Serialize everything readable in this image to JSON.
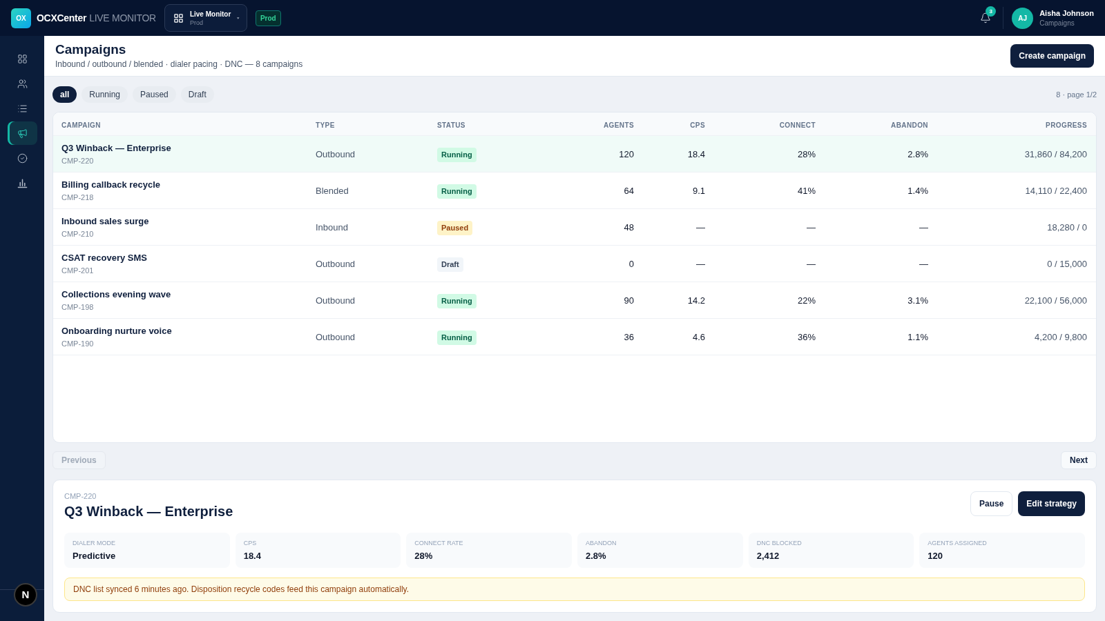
{
  "header": {
    "logo": {
      "mark": "OX",
      "name": "OCXCenter",
      "product": "LIVE MONITOR"
    },
    "workspace": {
      "title": "Live Monitor",
      "subtitle": "Prod"
    },
    "environment": "Prod",
    "notifications": {
      "count": "3"
    },
    "user": {
      "initials": "AJ",
      "name": "Aisha Johnson",
      "subtitle": "Campaigns"
    }
  },
  "sidebar": {
    "items": [
      {
        "selected": false
      },
      {
        "selected": false
      },
      {
        "selected": false
      },
      {
        "selected": true
      },
      {
        "selected": false
      },
      {
        "selected": false
      }
    ],
    "dev_indicator": "N"
  },
  "page": {
    "title": "Campaigns",
    "subtitle": "Inbound / outbound / blended · dialer pacing · DNC — 8 campaigns",
    "action": "Create campaign"
  },
  "filters": {
    "tabs": [
      {
        "label": "all",
        "selected": true
      },
      {
        "label": "Running",
        "selected": false
      },
      {
        "label": "Paused",
        "selected": false
      },
      {
        "label": "Draft",
        "selected": false
      }
    ],
    "summary": "8 · page 1/2"
  },
  "table": {
    "columns": [
      "CAMPAIGN",
      "TYPE",
      "STATUS",
      "AGENTS",
      "CPS",
      "CONNECT",
      "ABANDON",
      "PROGRESS"
    ],
    "rows": [
      {
        "name": "Q3 Winback — Enterprise",
        "id": "CMP-220",
        "type": "Outbound",
        "status": {
          "label": "Running",
          "kind": "running"
        },
        "agents": "120",
        "cps": "18.4",
        "connect": "28%",
        "abandon": "2.8%",
        "progress": "31,860 / 84,200",
        "selected": true
      },
      {
        "name": "Billing callback recycle",
        "id": "CMP-218",
        "type": "Blended",
        "status": {
          "label": "Running",
          "kind": "running"
        },
        "agents": "64",
        "cps": "9.1",
        "connect": "41%",
        "abandon": "1.4%",
        "progress": "14,110 / 22,400",
        "selected": false
      },
      {
        "name": "Inbound sales surge",
        "id": "CMP-210",
        "type": "Inbound",
        "status": {
          "label": "Paused",
          "kind": "paused"
        },
        "agents": "48",
        "cps": "—",
        "connect": "—",
        "abandon": "—",
        "progress": "18,280 / 0",
        "selected": false
      },
      {
        "name": "CSAT recovery SMS",
        "id": "CMP-201",
        "type": "Outbound",
        "status": {
          "label": "Draft",
          "kind": "draft"
        },
        "agents": "0",
        "cps": "—",
        "connect": "—",
        "abandon": "—",
        "progress": "0 / 15,000",
        "selected": false
      },
      {
        "name": "Collections evening wave",
        "id": "CMP-198",
        "type": "Outbound",
        "status": {
          "label": "Running",
          "kind": "running"
        },
        "agents": "90",
        "cps": "14.2",
        "connect": "22%",
        "abandon": "3.1%",
        "progress": "22,100 / 56,000",
        "selected": false
      },
      {
        "name": "Onboarding nurture voice",
        "id": "CMP-190",
        "type": "Outbound",
        "status": {
          "label": "Running",
          "kind": "running"
        },
        "agents": "36",
        "cps": "4.6",
        "connect": "36%",
        "abandon": "1.1%",
        "progress": "4,200 / 9,800",
        "selected": false
      }
    ]
  },
  "pagination": {
    "previous": {
      "label": "Previous",
      "disabled": true
    },
    "next": {
      "label": "Next",
      "disabled": false
    }
  },
  "detail": {
    "id": "CMP-220",
    "title": "Q3 Winback — Enterprise",
    "actions": [
      {
        "label": "Pause",
        "kind": "secondary"
      },
      {
        "label": "Edit strategy",
        "kind": "primary"
      }
    ],
    "stats": [
      {
        "label": "DIALER MODE",
        "value": "Predictive"
      },
      {
        "label": "CPS",
        "value": "18.4"
      },
      {
        "label": "CONNECT RATE",
        "value": "28%"
      },
      {
        "label": "ABANDON",
        "value": "2.8%"
      },
      {
        "label": "DNC BLOCKED",
        "value": "2,412"
      },
      {
        "label": "AGENTS ASSIGNED",
        "value": "120"
      }
    ],
    "notice": "DNC list synced 6 minutes ago. Disposition recycle codes feed this campaign automatically."
  }
}
